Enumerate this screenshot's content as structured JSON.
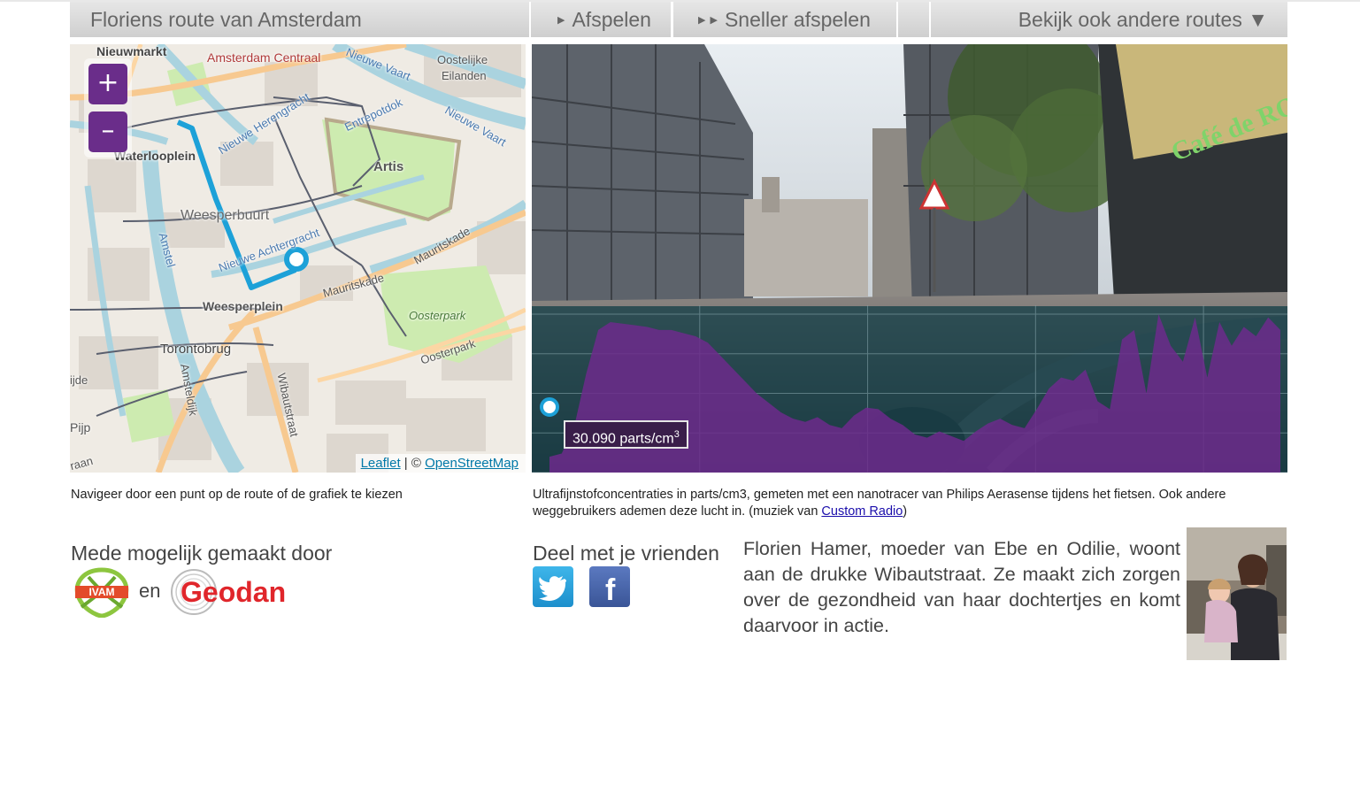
{
  "topbar": {
    "title": "Floriens route van Amsterdam",
    "play_label": "Afspelen",
    "fast_label": "Sneller afspelen",
    "routes_label": "Bekijk ook andere routes ▼"
  },
  "map": {
    "zoom_in": "+",
    "zoom_out": "–",
    "labels": {
      "nieuwmarkt": "Nieuwmarkt",
      "centraal": "Amsterdam Centraal",
      "oostelijke": "Oostelijke",
      "eilanden": "Eilanden",
      "nieuwe_vaart": "Nieuwe Vaart",
      "entrepotdok": "Entrepotdok",
      "herengracht": "Nieuwe Herengracht",
      "artis": "Artis",
      "waterlooplein": "Waterlooplein",
      "weesperbuurt": "Weesperbuurt",
      "amstel": "Amstel",
      "achtergracht": "Nieuwe Achtergracht",
      "mauritskade1": "Mauritskade",
      "mauritskade2": "Mauritskade",
      "weesperplein": "Weesperplein",
      "oosterpark": "Oosterpark",
      "oosterpark_road": "Oosterpark",
      "torontobrug": "Torontobrug",
      "amsteldijk": "Amsteldijk",
      "wibautstraat": "Wibautstraat",
      "ijde": "ijde",
      "pijp": "Pijp",
      "straat": "raan"
    },
    "attribution": {
      "leaflet": "Leaflet",
      "separator": " | © ",
      "osm": "OpenStreetMap"
    },
    "colors": {
      "route": "#1da1d8",
      "zoom": "#6a2d8a"
    }
  },
  "video": {
    "readout_value": "30.090 parts/cm",
    "readout_exp": "3",
    "sign_text": "Café de ROETER",
    "colors": {
      "chart_fill": "#6d2a8c"
    }
  },
  "captions": {
    "map_caption": "Navigeer door een punt op de route of de grafiek te kiezen",
    "video_caption_part1": "Ultrafijnstofconcentraties in parts/cm3, gemeten met een nanotracer van Philips Aerasense tijdens het fietsen. Ook andere weggebruikers ademen deze lucht in. (muziek van ",
    "video_caption_link": "Custom Radio",
    "video_caption_part2": ")"
  },
  "sponsors": {
    "heading": "Mede mogelijk gemaakt door",
    "ivam": "IVAM",
    "en": "en",
    "geodan": "Geodan"
  },
  "share": {
    "heading": "Deel met je vrienden",
    "twitter_glyph": "🐦",
    "facebook_glyph": "f"
  },
  "bio": {
    "text": "Florien Hamer, moeder van Ebe en Odilie, woont aan de drukke Wibautstraat. Ze maakt zich zorgen over de gezondheid van haar dochtertjes en komt daarvoor in actie."
  },
  "chart_data": {
    "type": "area",
    "title": "",
    "xlabel": "",
    "ylabel": "parts/cm3",
    "x": [
      0,
      1,
      2,
      3,
      4,
      5,
      6,
      7,
      8,
      9,
      10,
      11,
      12,
      13,
      14,
      15,
      16,
      17,
      18,
      19,
      20,
      21,
      22,
      23,
      24,
      25,
      26,
      27,
      28,
      29,
      30,
      31,
      32,
      33,
      34,
      35,
      36,
      37,
      38,
      39,
      40,
      41,
      42,
      43,
      44,
      45,
      46,
      47,
      48,
      49,
      50,
      51,
      52,
      53,
      54,
      55,
      56,
      57,
      58,
      59,
      60
    ],
    "values": [
      10,
      12,
      28,
      62,
      90,
      95,
      94,
      93,
      92,
      90,
      90,
      88,
      86,
      82,
      74,
      66,
      58,
      50,
      44,
      38,
      34,
      32,
      35,
      30,
      28,
      36,
      41,
      40,
      34,
      30,
      24,
      22,
      26,
      23,
      20,
      26,
      31,
      34,
      30,
      28,
      40,
      53,
      60,
      58,
      65,
      45,
      40,
      84,
      90,
      50,
      100,
      80,
      70,
      98,
      60,
      95,
      80,
      92,
      86,
      98,
      90
    ],
    "ylim": [
      0,
      100
    ],
    "grid": true,
    "current_index": 0
  }
}
